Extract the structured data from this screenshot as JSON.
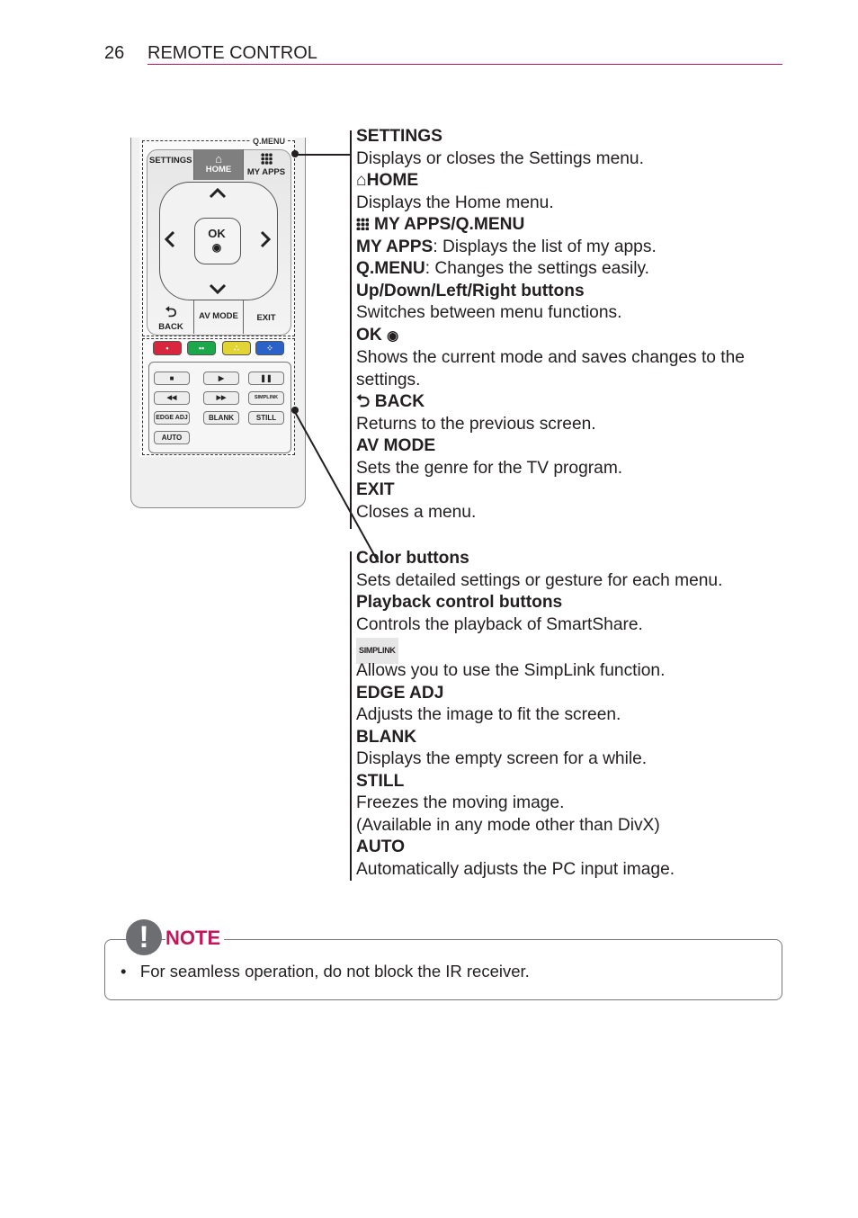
{
  "header": {
    "page_number": "26",
    "section_title": "REMOTE CONTROL",
    "accent_color": "#b5195f"
  },
  "remote": {
    "qmenu_label": "Q.MENU",
    "settings": "SETTINGS",
    "home": "HOME",
    "my_apps": "MY APPS",
    "ok": "OK",
    "ok_symbol": "◉",
    "back": "BACK",
    "back_symbol": "⮌",
    "av_mode": "AV MODE",
    "exit": "EXIT",
    "arrow_up": "⌃",
    "arrow_left": "‹",
    "arrow_right": "›",
    "arrow_down": "⌄",
    "color_buttons": [
      {
        "name": "red",
        "color": "#d7263d",
        "glyph": "•"
      },
      {
        "name": "green",
        "color": "#1aa84a",
        "glyph": "••"
      },
      {
        "name": "yellow",
        "color": "#e2d434",
        "glyph": "∴"
      },
      {
        "name": "blue",
        "color": "#2a62c9",
        "glyph": "⁘"
      }
    ],
    "playback": {
      "stop": "■",
      "play": "▶",
      "pause": "❚❚",
      "rewind": "◀◀",
      "fast_forward": "▶▶",
      "simplink": "SIMPLINK",
      "edge_adj": "EDGE ADJ",
      "blank": "BLANK",
      "still": "STILL",
      "auto": "AUTO"
    }
  },
  "descriptions_top": [
    {
      "title": "SETTINGS",
      "text": "Displays or closes the Settings menu."
    },
    {
      "title": "HOME",
      "icon": "⌂",
      "text": "Displays the Home menu."
    },
    {
      "title": "MY APPS/Q.MENU",
      "icon": "grid"
    },
    {
      "lead": "MY APPS",
      "text": ": Displays the list of my apps."
    },
    {
      "lead": "Q.MENU",
      "text": ": Changes the settings easily."
    },
    {
      "title": "Up/Down/Left/Right buttons",
      "text": "Switches between menu functions."
    },
    {
      "title": "OK",
      "icon": "◉",
      "text": "Shows the current mode and saves changes to the",
      "text2": "settings."
    },
    {
      "title": "BACK",
      "icon": "⮌",
      "text": "Returns to the previous screen."
    },
    {
      "title": "AV MODE",
      "text": "Sets the genre for the TV program."
    },
    {
      "title": "EXIT",
      "text": "Closes a menu."
    }
  ],
  "descriptions_bottom": [
    {
      "title": "Color buttons",
      "text": "Sets detailed settings or gesture for each menu."
    },
    {
      "title": "Playback control buttons",
      "text": "Controls the playback of SmartShare."
    },
    {
      "title": "SIMPLINK",
      "text": "Allows you to use the SimpLink function."
    },
    {
      "title": "EDGE ADJ",
      "text": "Adjusts the image to fit the screen."
    },
    {
      "title": "BLANK",
      "text": "Displays the empty screen for a while."
    },
    {
      "title": "STILL",
      "text": "Freezes the moving image.",
      "text2": "(Available in any mode other than DivX)"
    },
    {
      "title": "AUTO",
      "text": "Automatically adjusts the PC input image."
    }
  ],
  "note": {
    "label": "NOTE",
    "icon": "!",
    "label_color": "#c2185b",
    "bullets": [
      "For seamless operation, do not block the IR receiver."
    ]
  }
}
